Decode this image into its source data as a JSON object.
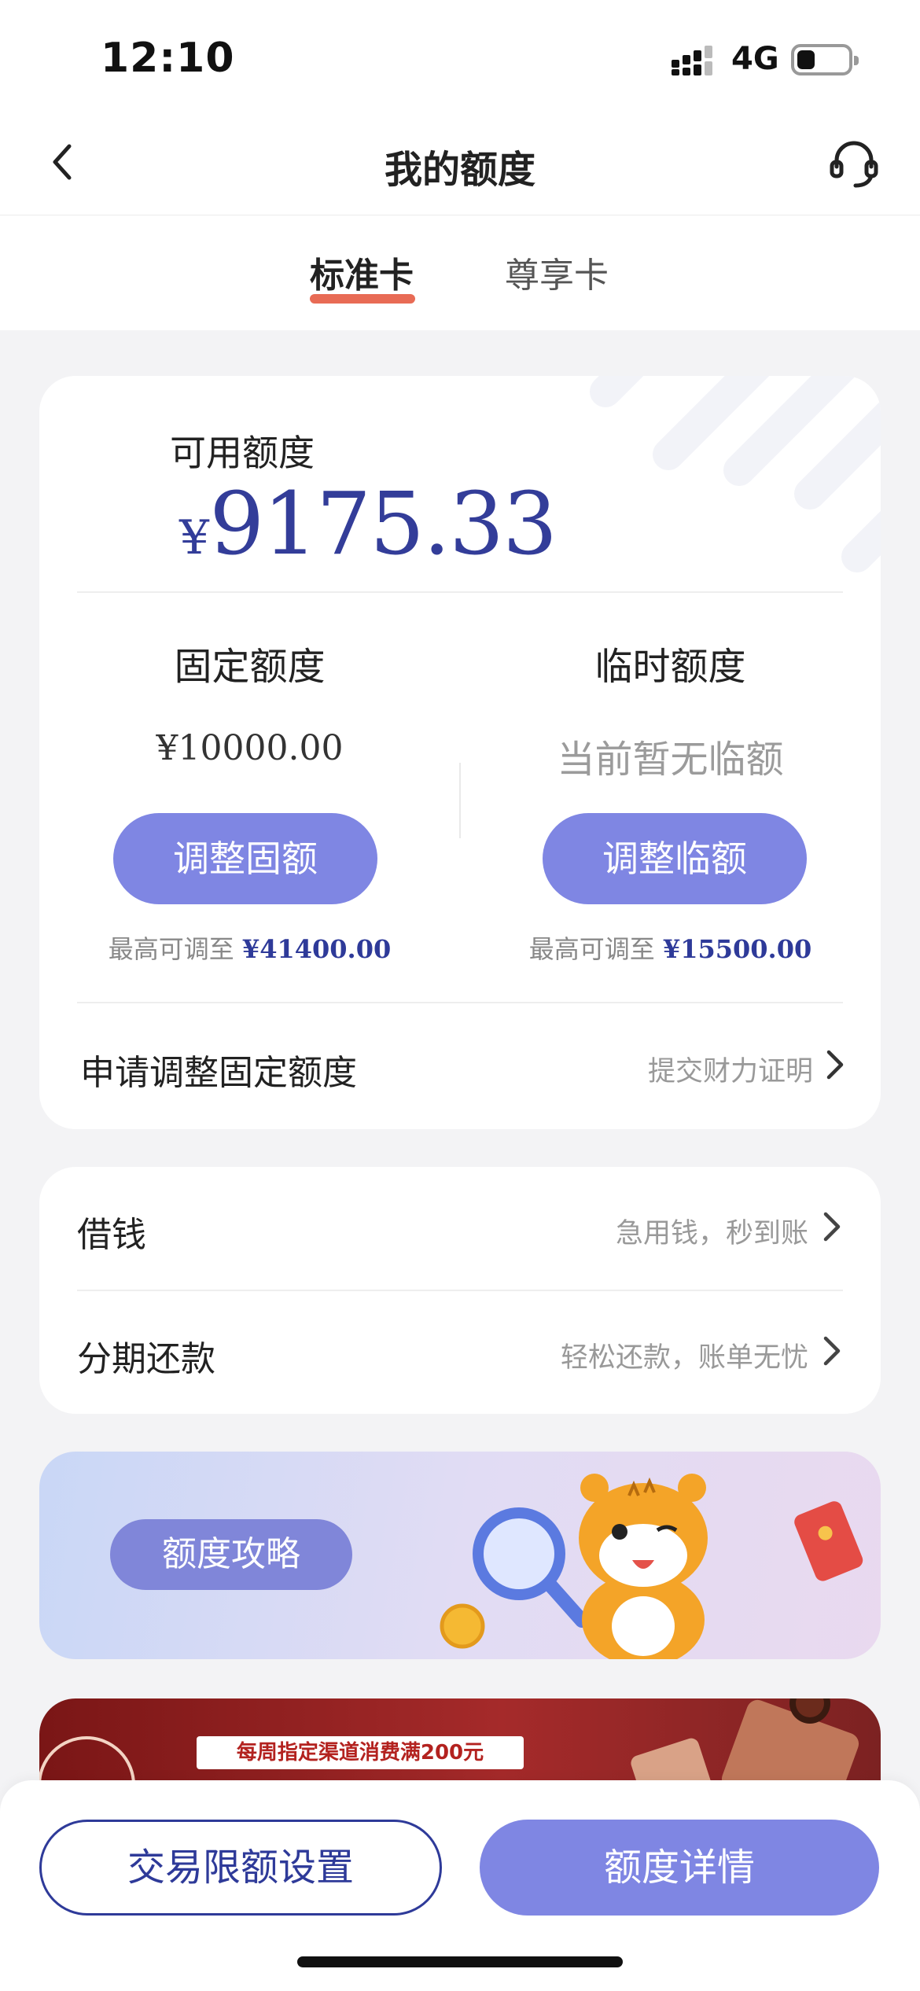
{
  "status_bar": {
    "time": "12:10",
    "network": "4G",
    "battery_level": 0.35
  },
  "nav": {
    "title": "我的额度"
  },
  "tabs": [
    {
      "label": "标准卡",
      "active": true
    },
    {
      "label": "尊享卡",
      "active": false
    }
  ],
  "credit_card": {
    "available_label": "可用额度",
    "available_currency": "¥",
    "available_amount": "9175.33",
    "fixed": {
      "title": "固定额度",
      "value": "¥10000.00",
      "button": "调整固额",
      "hint_prefix": "最高可调至",
      "hint_value": "¥41400.00"
    },
    "temp": {
      "title": "临时额度",
      "value": "当前暂无临额",
      "button": "调整临额",
      "hint_prefix": "最高可调至",
      "hint_value": "¥15500.00"
    },
    "apply_row": {
      "label": "申请调整固定额度",
      "sub": "提交财力证明"
    }
  },
  "services": [
    {
      "label": "借钱",
      "sub": "急用钱，秒到账"
    },
    {
      "label": "分期还款",
      "sub": "轻松还款，账单无忧"
    }
  ],
  "banner": {
    "pill": "额度攻略"
  },
  "promo": {
    "text": "每周指定渠道消费满200元"
  },
  "bottom": {
    "left_button": "交易限额设置",
    "right_button": "额度详情"
  },
  "colors": {
    "accent": "#7f86e3",
    "brand_blue": "#2e3a99",
    "tab_underline": "#e86b55",
    "amount": "#333d99"
  }
}
